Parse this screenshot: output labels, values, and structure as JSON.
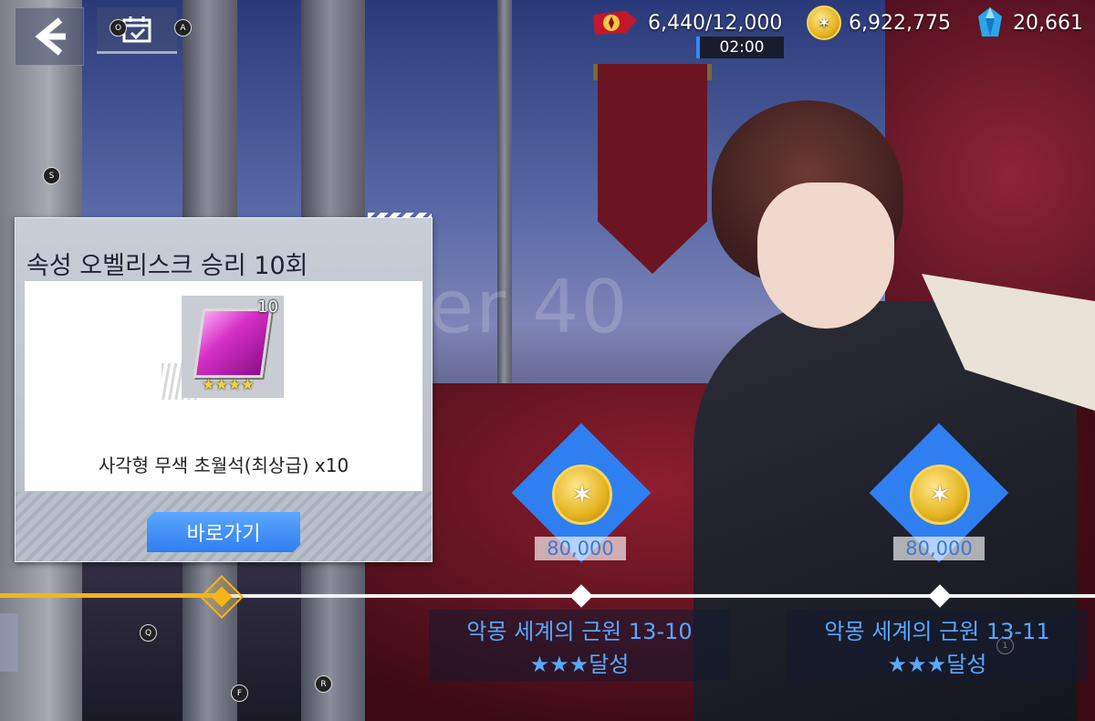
{
  "resources": {
    "stamina": "6,440/12,000",
    "stamina_timer": "02:00",
    "gold": "6,922,775",
    "crystal": "20,661"
  },
  "hints": {
    "o": "O",
    "a": "A",
    "s": "S",
    "q": "Q",
    "f": "F",
    "r": "R",
    "one": "1"
  },
  "background": {
    "watermark": "er 40"
  },
  "mission": {
    "title": "속성 오벨리스크 승리 10회",
    "item_count": "10",
    "item_stars": "★★★★",
    "reward_text": "사각형 무색 초월석(최상급) x10",
    "go_button": "바로가기"
  },
  "rewards": [
    {
      "amount": "80,000",
      "stage": "악몽 세계의 근원 13-10",
      "condition": "★★★달성"
    },
    {
      "amount": "80,000",
      "stage": "악몽 세계의 근원 13-11",
      "condition": "★★★달성"
    }
  ],
  "colors": {
    "accent_blue": "#2f7ff0",
    "progress_gold": "#f4b41a",
    "stage_text": "#5aa8ff"
  }
}
